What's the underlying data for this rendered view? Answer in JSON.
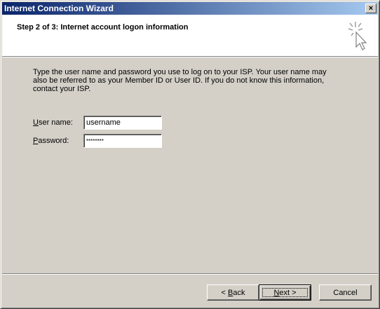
{
  "window": {
    "title": "Internet Connection Wizard",
    "close_label": "×"
  },
  "header": {
    "step_title": "Step 2 of 3: Internet account logon information",
    "icon": "wizard-sparkle-cursor-icon"
  },
  "body": {
    "description": "Type the user name and password you use to log on to your ISP. Your user name may also be referred to as your Member ID or User ID. If you do not know this information, contact your ISP.",
    "username_label_accel": "U",
    "username_label_rest": "ser name:",
    "username_value": "username",
    "password_label_accel": "P",
    "password_label_rest": "assword:",
    "password_value": "********"
  },
  "buttons": {
    "back_prefix": "< ",
    "back_accel": "B",
    "back_rest": "ack",
    "next_accel": "N",
    "next_rest": "ext >",
    "cancel": "Cancel"
  }
}
